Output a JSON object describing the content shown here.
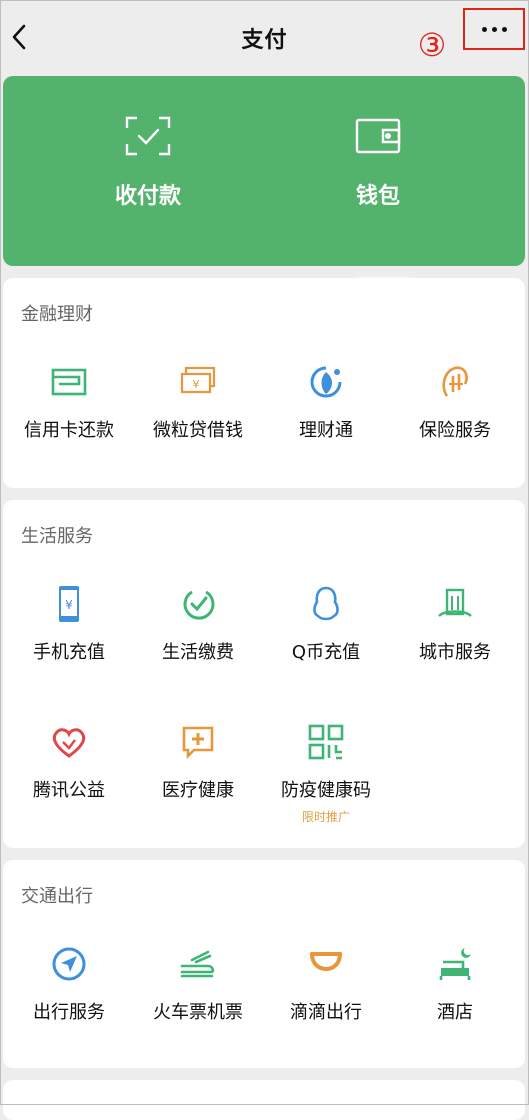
{
  "header": {
    "title": "支付",
    "step_marker": "③"
  },
  "hero": {
    "items": [
      {
        "label": "收付款",
        "icon": "scan-pay-icon"
      },
      {
        "label": "钱包",
        "icon": "wallet-icon"
      }
    ],
    "color": "#53b26c"
  },
  "sections": [
    {
      "title": "金融理财",
      "items": [
        {
          "label": "信用卡还款",
          "icon": "credit-card-icon"
        },
        {
          "label": "微粒贷借钱",
          "icon": "loan-cash-icon"
        },
        {
          "label": "理财通",
          "icon": "wealth-icon"
        },
        {
          "label": "保险服务",
          "icon": "insurance-icon"
        }
      ]
    },
    {
      "title": "生活服务",
      "items": [
        {
          "label": "手机充值",
          "icon": "phone-topup-icon"
        },
        {
          "label": "生活缴费",
          "icon": "utility-bill-icon"
        },
        {
          "label": "Q币充值",
          "icon": "qq-coin-icon"
        },
        {
          "label": "城市服务",
          "icon": "city-service-icon"
        },
        {
          "label": "腾讯公益",
          "icon": "charity-icon"
        },
        {
          "label": "医疗健康",
          "icon": "medical-icon"
        },
        {
          "label": "防疫健康码",
          "icon": "health-code-icon",
          "sub": "限时推广"
        }
      ]
    },
    {
      "title": "交通出行",
      "items": [
        {
          "label": "出行服务",
          "icon": "travel-icon"
        },
        {
          "label": "火车票机票",
          "icon": "train-ticket-icon"
        },
        {
          "label": "滴滴出行",
          "icon": "didi-icon"
        },
        {
          "label": "酒店",
          "icon": "hotel-icon"
        }
      ]
    }
  ]
}
